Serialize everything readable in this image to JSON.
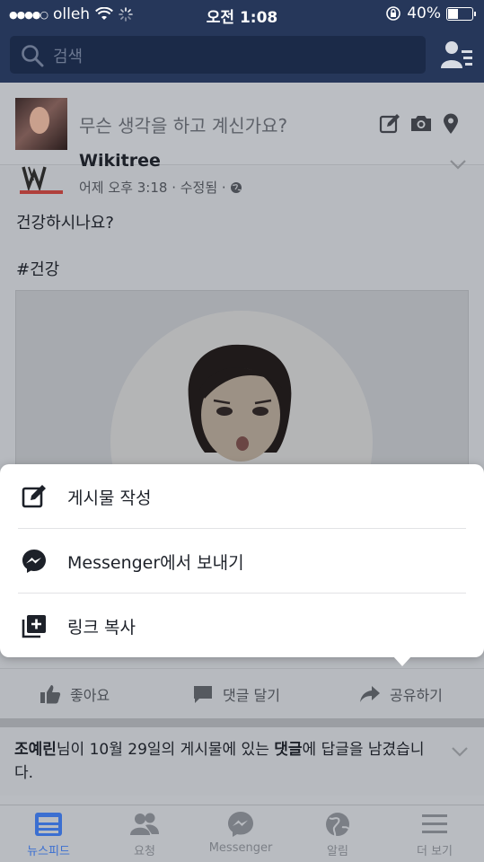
{
  "status_bar": {
    "carrier": "olleh",
    "signal_dots": "●●●●○",
    "time": "오전 1:08",
    "battery": "40%"
  },
  "search": {
    "placeholder": "검색"
  },
  "composer": {
    "placeholder": "무슨 생각을 하고 계신가요?"
  },
  "post": {
    "page_name": "Wikitree",
    "meta": "어제 오후 3:18 · 수정됨 ·",
    "text1": "건강하시나요?",
    "text2": "#건강"
  },
  "share_sheet": {
    "items": [
      {
        "label": "게시물 작성",
        "icon": "edit-icon"
      },
      {
        "label": "Messenger에서 보내기",
        "icon": "messenger-icon"
      },
      {
        "label": "링크 복사",
        "icon": "copy-link-icon"
      }
    ]
  },
  "actions": {
    "like": "좋아요",
    "comment": "댓글 달기",
    "share": "공유하기"
  },
  "notification": {
    "name": "조예린",
    "part1": "님이 10월 29일의 게시물에 있는 ",
    "bold2": "댓글",
    "part2": "에 답글을 남겼습니다."
  },
  "tabs": [
    {
      "label": "뉴스피드",
      "active": true
    },
    {
      "label": "요청",
      "active": false
    },
    {
      "label": "Messenger",
      "active": false
    },
    {
      "label": "알림",
      "active": false
    },
    {
      "label": "더 보기",
      "active": false
    }
  ],
  "colors": {
    "nav_blue": "#26375a",
    "accent": "#3b6fd1"
  }
}
